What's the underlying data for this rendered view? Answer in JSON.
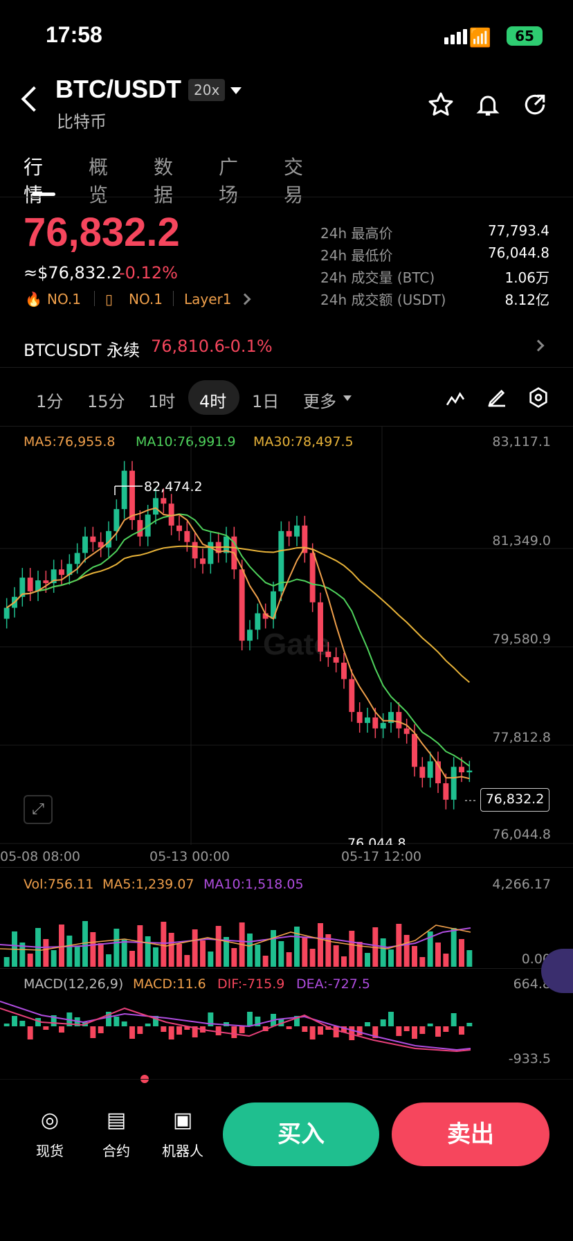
{
  "status": {
    "time": "17:58",
    "battery": "65"
  },
  "header": {
    "pair": "BTC/USDT",
    "leverage": "20x",
    "name": "比特币"
  },
  "tabs": [
    "行情",
    "概览",
    "数据",
    "广场",
    "交易"
  ],
  "ticker": {
    "price": "76,832.2",
    "usd_price": "≈$76,832.2",
    "change": "-0.12%",
    "tags": [
      "NO.1",
      "NO.1",
      "Layer1"
    ],
    "stats": [
      {
        "label": "24h 最高价",
        "value": "77,793.4"
      },
      {
        "label": "24h 最低价",
        "value": "76,044.8"
      },
      {
        "label": "24h 成交量 (BTC)",
        "value": "1.06万"
      },
      {
        "label": "24h 成交额 (USDT)",
        "value": "8.12亿"
      }
    ]
  },
  "perp": {
    "name": "BTCUSDT 永续",
    "price": "76,810.6",
    "change": "-0.1%"
  },
  "timeframes": [
    "1分",
    "15分",
    "1时",
    "4时",
    "1日",
    "更多"
  ],
  "active_timeframe": "4时",
  "ma": {
    "ma5": "MA5:76,955.8",
    "ma10": "MA10:76,991.9",
    "ma30": "MA30:78,497.5"
  },
  "price_axis": [
    "83,117.1",
    "81,349.0",
    "79,580.9",
    "77,812.8",
    "76,044.8"
  ],
  "high_marker": "82,474.2",
  "low_marker": "76,044.8",
  "last_price_tag": "76,832.2",
  "dates": [
    "05-08 08:00",
    "05-13 00:00",
    "05-17 12:00"
  ],
  "vol": {
    "vol": "Vol:756.11",
    "ma5": "MA5:1,239.07",
    "ma10": "MA10:1,518.05",
    "top": "4,266.17",
    "zero": "0.00"
  },
  "macd": {
    "title": "MACD(12,26,9)",
    "macd": "MACD:11.6",
    "dif": "DIF:-715.9",
    "dea": "DEA:-727.5",
    "top": "664.8",
    "bottom": "-933.5"
  },
  "bottom": {
    "spot": "现货",
    "contract": "合约",
    "bot": "机器人",
    "buy": "买入",
    "sell": "卖出"
  },
  "colors": {
    "up": "#1fbf8f",
    "down": "#f6465d",
    "ma5": "#f0a04b",
    "ma10": "#4fd35c",
    "ma30": "#e8b339",
    "purple": "#b04de0"
  },
  "chart_data": {
    "type": "candlestick",
    "interval": "4时",
    "ylim": [
      76044.8,
      83117.1
    ],
    "candles_close": [
      79800,
      80000,
      80350,
      80100,
      80300,
      80250,
      80500,
      80400,
      80600,
      80800,
      81100,
      81000,
      80900,
      81200,
      81600,
      82300,
      81400,
      81100,
      81500,
      81800,
      81700,
      81300,
      81200,
      81000,
      80700,
      80600,
      81000,
      80800,
      81100,
      80500,
      79200,
      79400,
      79700,
      79600,
      80100,
      81200,
      81100,
      81300,
      80800,
      79900,
      79000,
      78900,
      78800,
      78500,
      77900,
      77700,
      77800,
      77600,
      77700,
      77900,
      77600,
      77500,
      76900,
      76700,
      77000,
      76600,
      76300,
      76900,
      76800,
      76832.2
    ],
    "highs_labeled": {
      "high": 82474.2,
      "low": 76044.8
    }
  }
}
